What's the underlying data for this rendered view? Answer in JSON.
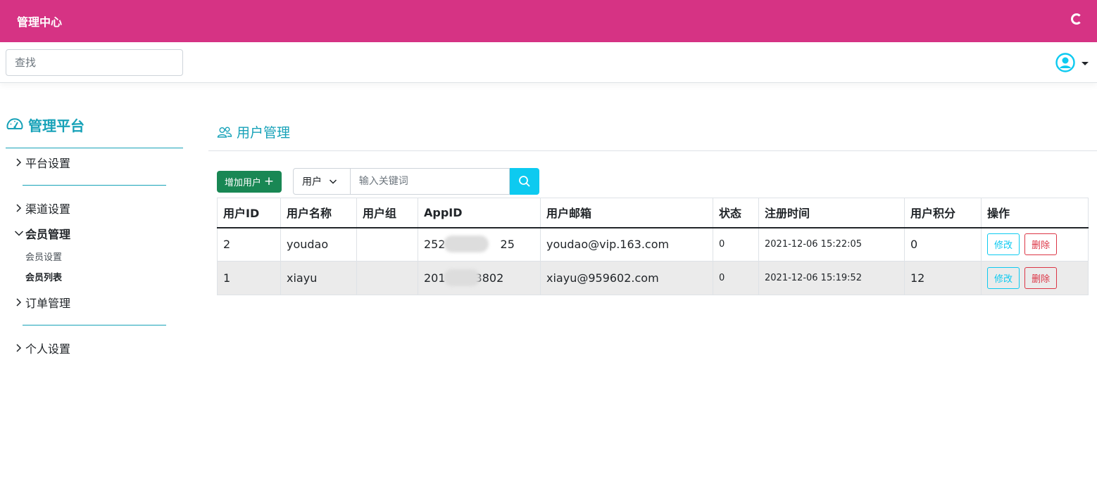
{
  "header": {
    "title": "管理中心"
  },
  "toolbar": {
    "search_placeholder": "查找"
  },
  "sidebar": {
    "brand": "管理平台",
    "items": [
      {
        "label": "平台设置"
      },
      {
        "label": "渠道设置"
      },
      {
        "label": "会员管理",
        "sub": [
          "会员设置",
          "会员列表"
        ]
      },
      {
        "label": "订单管理"
      },
      {
        "label": "个人设置"
      }
    ]
  },
  "page": {
    "title": "用户管理"
  },
  "actions": {
    "add_label": "增加用户",
    "filter_select": "用户",
    "keyword_placeholder": "输入关键词"
  },
  "table": {
    "headers": [
      "用户ID",
      "用户名称",
      "用户组",
      "AppID",
      "用户邮箱",
      "状态",
      "注册时间",
      "用户积分",
      "操作"
    ],
    "rows": [
      {
        "id": "2",
        "name": "youdao",
        "group": "",
        "appid_prefix": "252",
        "appid_suffix": "25",
        "email": "youdao@vip.163.com",
        "status": "0",
        "registered": "2021-12-06 15:22:05",
        "points": "0"
      },
      {
        "id": "1",
        "name": "xiayu",
        "group": "",
        "appid_prefix": "201",
        "appid_suffix": "3802",
        "email": "xiayu@959602.com",
        "status": "0",
        "registered": "2021-12-06 15:19:52",
        "points": "12"
      }
    ],
    "edit_label": "修改",
    "delete_label": "删除"
  },
  "colors": {
    "header_bg": "#d63384",
    "accent": "#17a2b8",
    "add_button": "#198754",
    "search_button": "#0dcaf0",
    "delete": "#dc3545"
  },
  "icons": [
    "loading-spinner-icon",
    "user-avatar-icon",
    "dashboard-gauge-icon",
    "chevron-right-icon",
    "chevron-down-icon",
    "users-icon",
    "plus-icon",
    "search-icon"
  ]
}
